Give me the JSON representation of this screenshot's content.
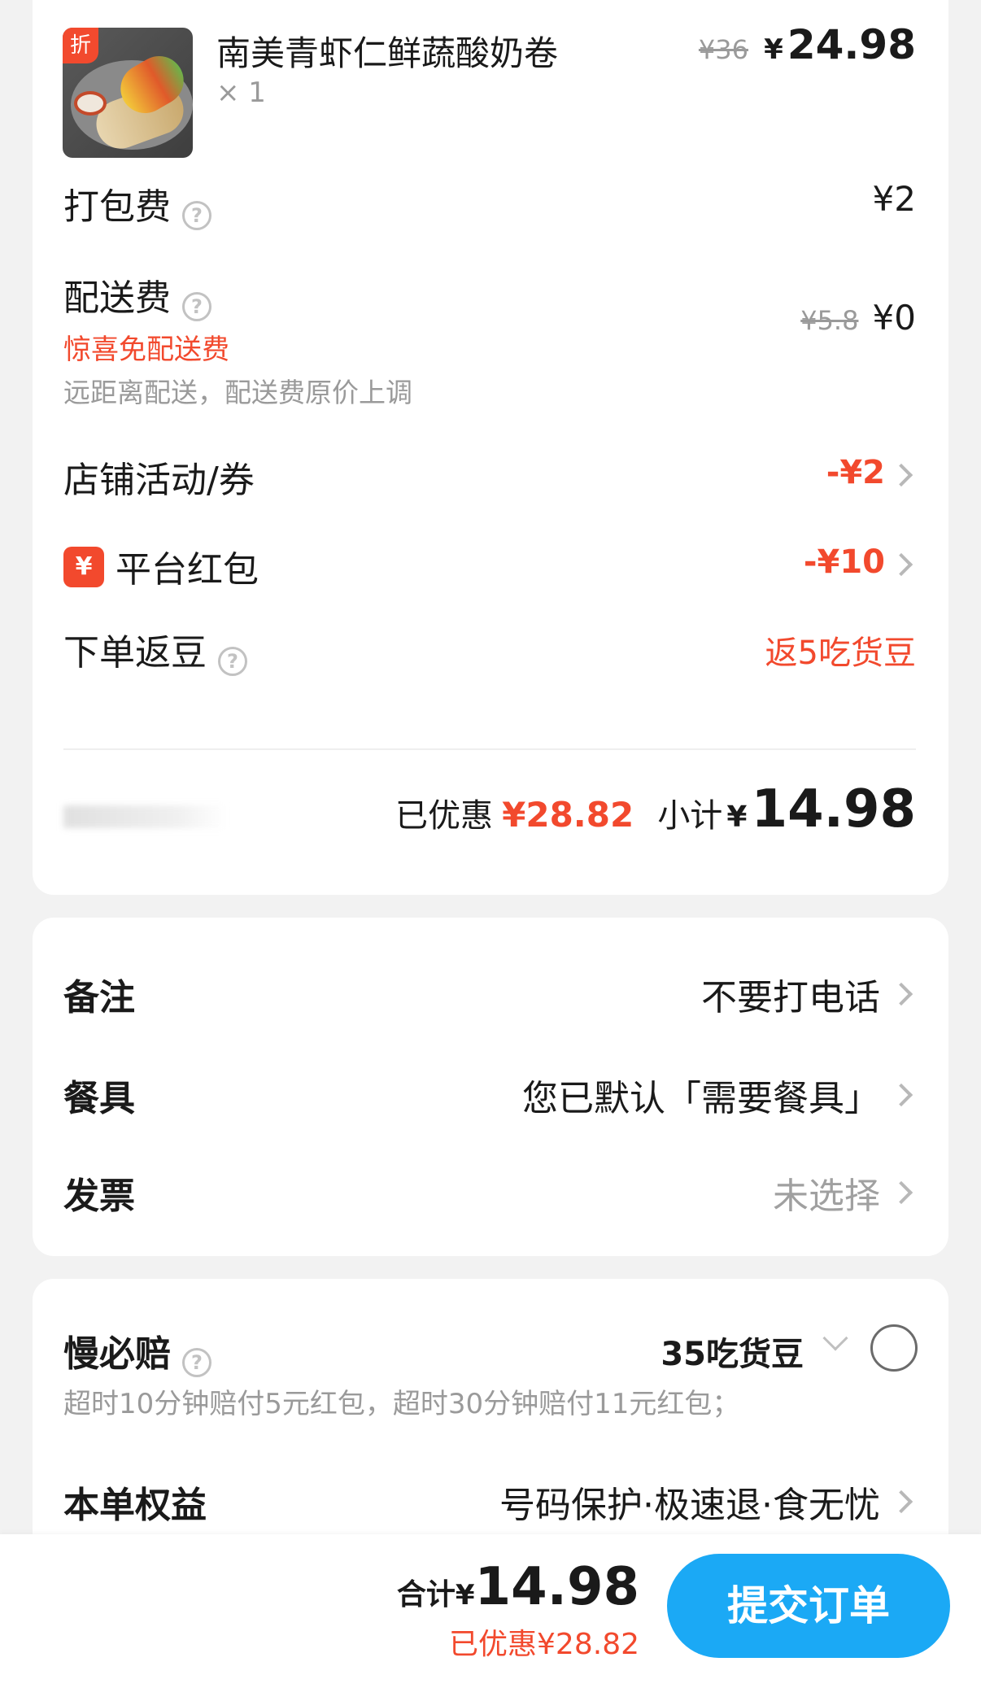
{
  "item": {
    "badge": "折",
    "name": "南美青虾仁鲜蔬酸奶卷",
    "qty": "× 1",
    "orig_price": "¥36",
    "currency": "¥",
    "price": "24.98",
    "image_icon": "burrito-food-image"
  },
  "fees": {
    "packing_label": "打包费",
    "packing_value": "¥2",
    "delivery_label": "配送费",
    "delivery_promo": "惊喜免配送费",
    "delivery_note": "远距离配送，配送费原价上调",
    "delivery_orig": "¥5.8",
    "delivery_value": "¥0",
    "store_label": "店铺活动/券",
    "store_value": "-¥2",
    "redpacket_icon": "¥",
    "redpacket_label": "平台红包",
    "redpacket_value": "-¥10",
    "beans_label": "下单返豆",
    "beans_value": "返5吃货豆"
  },
  "subtotal": {
    "saved_label": "已优惠",
    "saved_value": "¥28.82",
    "label": "小计",
    "currency": "¥",
    "value": "14.98"
  },
  "options": {
    "remark_label": "备注",
    "remark_value": "不要打电话",
    "utensils_label": "餐具",
    "utensils_value": "您已默认「需要餐具」",
    "invoice_label": "发票",
    "invoice_value": "未选择"
  },
  "benefits": {
    "slow_label": "慢必赔",
    "slow_value": "35吃货豆",
    "slow_desc": "超时10分钟赔付5元红包，超时30分钟赔付11元红包；",
    "rights_label": "本单权益",
    "rights_value": "号码保护·极速退·食无忧"
  },
  "footer": {
    "total_label": "合计",
    "currency": "¥",
    "total_value": "14.98",
    "saved_text": "已优惠¥28.82",
    "submit_label": "提交订单"
  },
  "colors": {
    "accent_red": "#f2492d",
    "submit_blue": "#1ba9f5"
  }
}
